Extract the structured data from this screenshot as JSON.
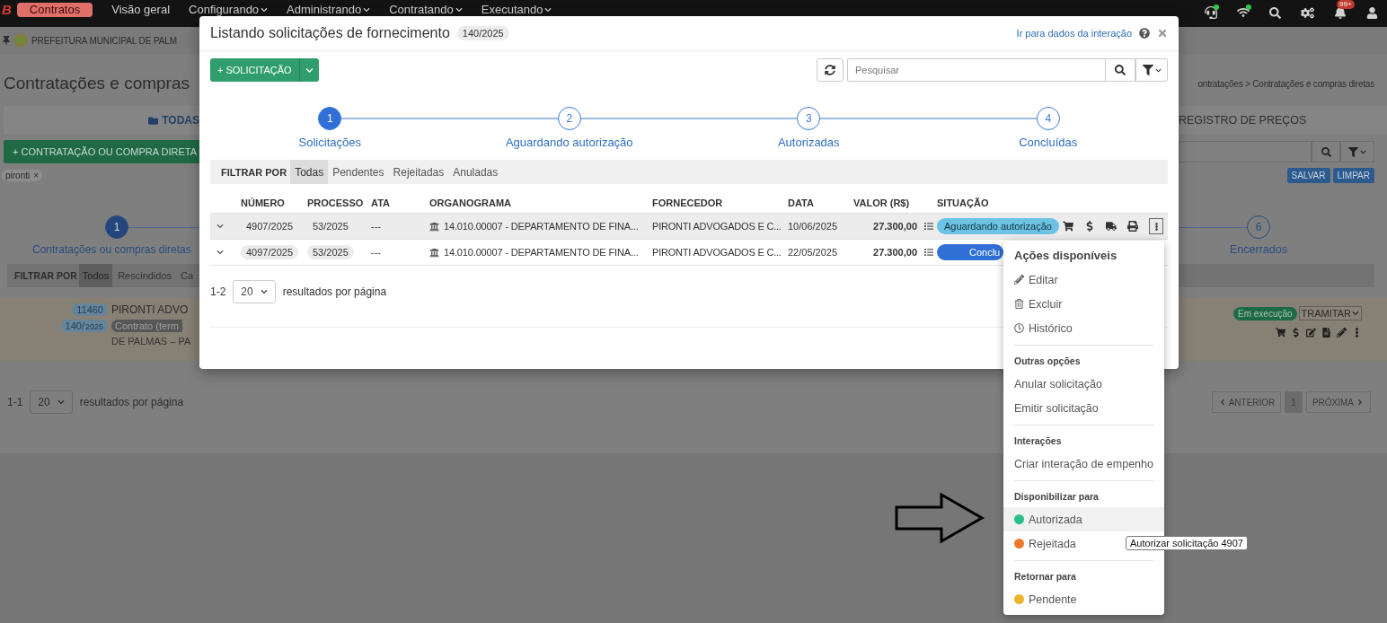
{
  "nav": {
    "logo": "B",
    "app": "Contratos",
    "items": [
      {
        "label": "Visão geral",
        "has_menu": false
      },
      {
        "label": "Configurando",
        "has_menu": true
      },
      {
        "label": "Administrando",
        "has_menu": true
      },
      {
        "label": "Contratando",
        "has_menu": true
      },
      {
        "label": "Executando",
        "has_menu": true
      }
    ],
    "notifications_badge": "99+"
  },
  "background": {
    "org": "PREFEITURA MUNICIPAL DE PALM",
    "title": "Contratações e compras",
    "breadcrumb": "ontratações > Contratações e compras diretas",
    "tabs": [
      {
        "label": "TODAS",
        "selected": true
      },
      {
        "label": "REGISTRO DE PREÇOS",
        "selected": false
      }
    ],
    "new_button": "+ CONTRATAÇÃO OU COMPRA DIRETA",
    "filter_chip": "pironti",
    "chip_close": "×",
    "save_button": "SALVAR",
    "clear_button": "LIMPAR",
    "steps": [
      {
        "number": "1",
        "label": "Contratações ou compras diretas",
        "selected": true
      },
      {
        "number": "6",
        "label": "Encerrados",
        "selected": false
      }
    ],
    "filter": {
      "label": "FILTRAR POR",
      "options": [
        {
          "label": "Todos",
          "selected": true
        },
        {
          "label": "Rescindidos",
          "selected": false
        },
        {
          "label": "Ca",
          "selected": false
        }
      ]
    },
    "record": {
      "id": "11460",
      "number": "140/",
      "year": "2025",
      "supplier": "PIRONTI ADVO",
      "type": "Contrato (term",
      "location": "DE PALMAS – PA",
      "status": "Em execução",
      "action": "TRAMITAR"
    },
    "pagination": {
      "range": "1-1",
      "page_size": "20",
      "label": "resultados por página",
      "prev": "ANTERIOR",
      "page": "1",
      "next": "PRÓXIMA"
    }
  },
  "modal": {
    "title": "Listando solicitações de fornecimento",
    "badge": "140/2025",
    "link": "Ir para dados da interação",
    "new_button": "+ SOLICITAÇÃO",
    "search_placeholder": "Pesquisar",
    "steps": [
      {
        "number": "1",
        "label": "Solicitações",
        "selected": true
      },
      {
        "number": "2",
        "label": "Aguardando autorização",
        "selected": false
      },
      {
        "number": "3",
        "label": "Autorizadas",
        "selected": false
      },
      {
        "number": "4",
        "label": "Concluídas",
        "selected": false
      }
    ],
    "filter": {
      "label": "FILTRAR POR",
      "options": [
        {
          "label": "Todas",
          "selected": true
        },
        {
          "label": "Pendentes",
          "selected": false
        },
        {
          "label": "Rejeitadas",
          "selected": false
        },
        {
          "label": "Anuladas",
          "selected": false
        }
      ]
    },
    "table": {
      "columns": [
        "NÚMERO",
        "PROCESSO",
        "ATA",
        "ORGANOGRAMA",
        "FORNECEDOR",
        "DATA",
        "VALOR (R$)",
        "SITUAÇÃO"
      ],
      "rows": [
        {
          "number": "4907/2025",
          "process": "53/2025",
          "ata": "---",
          "org": "14.010.00007 - DEPARTAMENTO DE FINA...",
          "supplier": "PIRONTI ADVOGADOS E C...",
          "date": "10/06/2025",
          "value": "27.300,00",
          "status": "Aguardando autorização",
          "color": "#6cc3e4",
          "menu_open": true
        },
        {
          "number": "4097/2025",
          "process": "53/2025",
          "ata": "---",
          "org": "14.010.00007 - DEPARTAMENTO DE FINA...",
          "supplier": "PIRONTI ADVOGADOS E C...",
          "date": "22/05/2025",
          "value": "27.300,00",
          "status": "Conclu",
          "color": "#2f6fd6",
          "menu_open": false
        }
      ]
    },
    "pagination": {
      "range": "1-2",
      "page_size": "20",
      "label": "resultados por página"
    }
  },
  "menu": {
    "title": "Ações disponíveis",
    "sections": [
      {
        "items": [
          {
            "label": "Editar",
            "kind": "edit",
            "hovered": false
          },
          {
            "label": "Excluir",
            "kind": "delete",
            "hovered": false
          },
          {
            "label": "Histórico",
            "kind": "history",
            "hovered": false
          }
        ]
      },
      {
        "heading": "Outras opções",
        "items": [
          {
            "label": "Anular solicitação",
            "kind": "plain",
            "hovered": false
          },
          {
            "label": "Emitir solicitação",
            "kind": "plain",
            "hovered": false
          }
        ]
      },
      {
        "heading": "Interações",
        "items": [
          {
            "label": "Criar interação de empenho",
            "kind": "plain",
            "hovered": false
          }
        ]
      },
      {
        "heading": "Disponibilizar para",
        "items": [
          {
            "label": "Autorizada",
            "kind": "status",
            "color": "#2dbe87",
            "hovered": true
          },
          {
            "label": "Rejeitada",
            "kind": "status",
            "color": "#ec7a2c",
            "hovered": false
          }
        ]
      },
      {
        "heading": "Retornar para",
        "items": [
          {
            "label": "Pendente",
            "kind": "status",
            "color": "#e9b62b",
            "hovered": false
          }
        ]
      }
    ]
  },
  "tooltip": "Autorizar solicitação 4907"
}
